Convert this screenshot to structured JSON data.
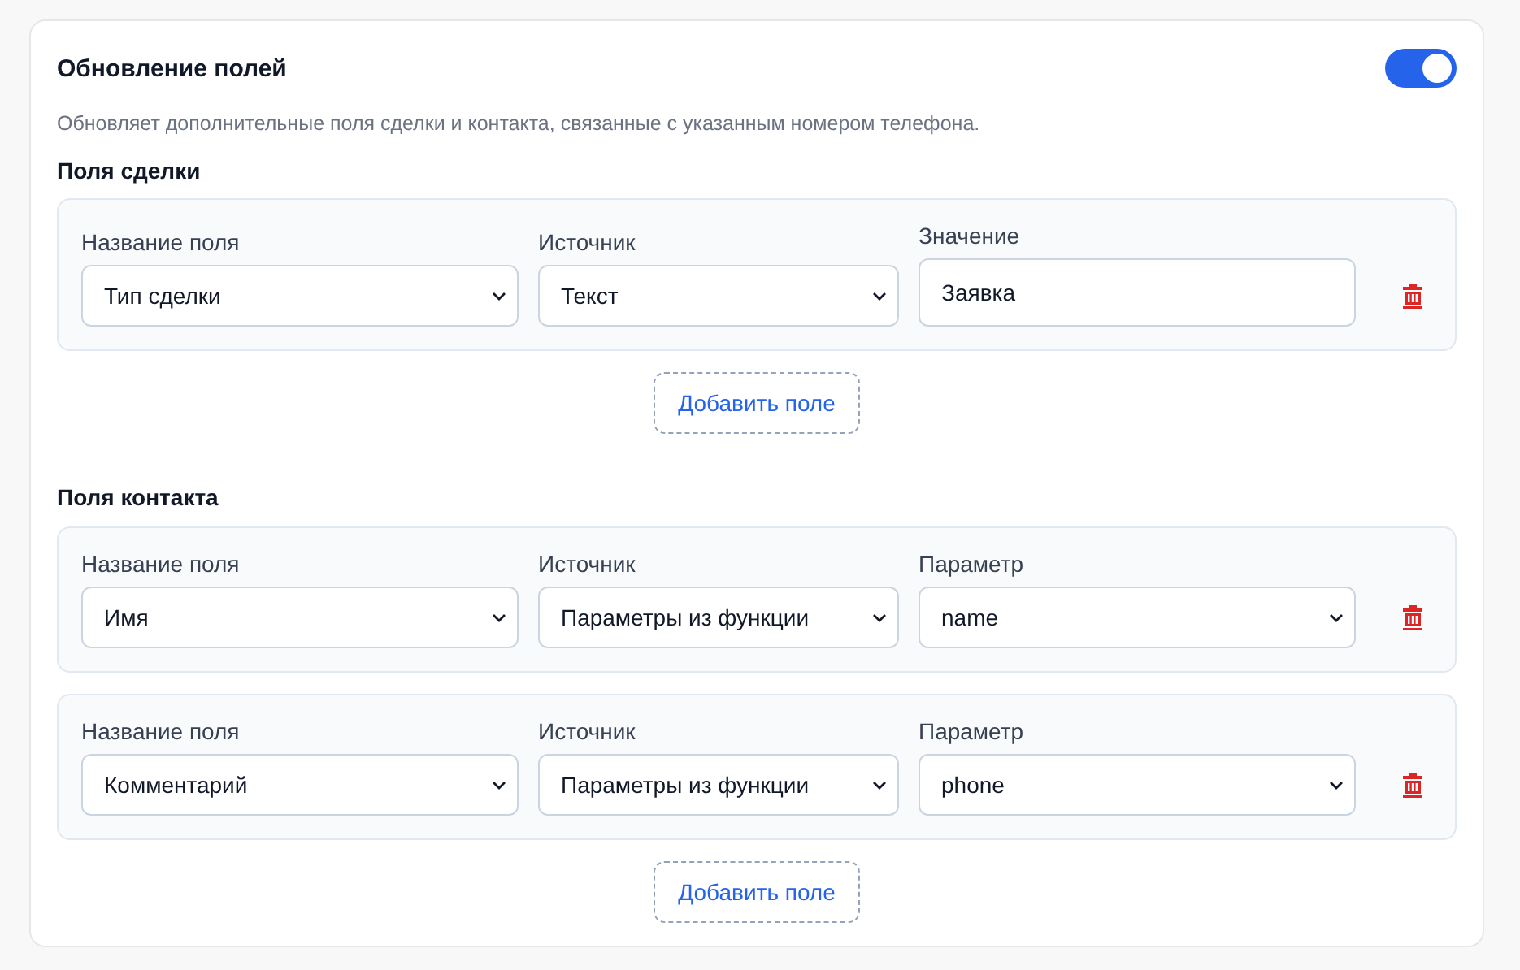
{
  "title": "Обновление полей",
  "toggle": {
    "on": true
  },
  "description": "Обновляет дополнительные поля сделки и контакта, связанные с указанным номером телефона.",
  "sections": [
    {
      "heading": "Поля сделки",
      "rows": [
        {
          "fields": [
            {
              "kind": "select",
              "label": "Название поля",
              "value": "Тип сделки"
            },
            {
              "kind": "select",
              "label": "Источник",
              "value": "Текст"
            },
            {
              "kind": "input",
              "label": "Значение",
              "value": "Заявка"
            }
          ]
        }
      ],
      "add_button": "Добавить поле"
    },
    {
      "heading": "Поля контакта",
      "rows": [
        {
          "fields": [
            {
              "kind": "select",
              "label": "Название поля",
              "value": "Имя"
            },
            {
              "kind": "select",
              "label": "Источник",
              "value": "Параметры из функции"
            },
            {
              "kind": "select",
              "label": "Параметр",
              "value": "name"
            }
          ]
        },
        {
          "fields": [
            {
              "kind": "select",
              "label": "Название поля",
              "value": "Комментарий"
            },
            {
              "kind": "select",
              "label": "Источник",
              "value": "Параметры из функции"
            },
            {
              "kind": "select",
              "label": "Параметр",
              "value": "phone"
            }
          ]
        }
      ],
      "add_button": "Добавить поле"
    }
  ]
}
